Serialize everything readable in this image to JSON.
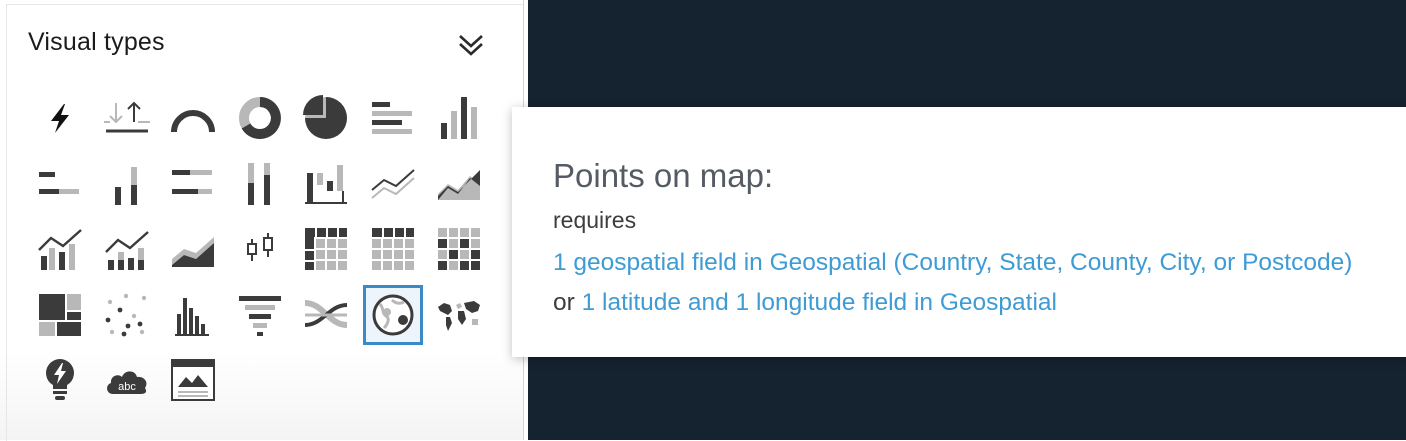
{
  "panel": {
    "title": "Visual types",
    "collapse_icon": "double-chevron-down-icon"
  },
  "visual_types": [
    {
      "name": "autograph",
      "icon": "lightning-bolt-icon"
    },
    {
      "name": "kpi",
      "icon": "kpi-arrows-icon"
    },
    {
      "name": "gauge-chart",
      "icon": "gauge-icon"
    },
    {
      "name": "donut-chart",
      "icon": "donut-icon"
    },
    {
      "name": "pie-chart",
      "icon": "pie-icon"
    },
    {
      "name": "horizontal-bar-chart",
      "icon": "horizontal-bar-icon"
    },
    {
      "name": "vertical-bar-chart",
      "icon": "vertical-bar-icon"
    },
    {
      "name": "horizontal-stacked-bar-chart",
      "icon": "horizontal-stacked-bar-icon"
    },
    {
      "name": "vertical-stacked-bar-chart",
      "icon": "vertical-stacked-bar-icon"
    },
    {
      "name": "horizontal-stacked-100-bar-chart",
      "icon": "horizontal-stacked-100-bar-icon"
    },
    {
      "name": "vertical-stacked-100-bar-chart",
      "icon": "vertical-stacked-100-bar-icon"
    },
    {
      "name": "waterfall-chart",
      "icon": "waterfall-icon"
    },
    {
      "name": "line-chart",
      "icon": "line-chart-icon"
    },
    {
      "name": "area-line-chart",
      "icon": "area-chart-icon"
    },
    {
      "name": "clustered-bar-combo-chart",
      "icon": "bar-line-combo-icon"
    },
    {
      "name": "stacked-bar-combo-chart",
      "icon": "stacked-bar-line-combo-icon"
    },
    {
      "name": "stacked-area-chart",
      "icon": "stacked-area-icon"
    },
    {
      "name": "box-plot",
      "icon": "box-plot-icon"
    },
    {
      "name": "pivot-table",
      "icon": "pivot-table-icon"
    },
    {
      "name": "table",
      "icon": "table-icon"
    },
    {
      "name": "heat-map",
      "icon": "heat-map-icon"
    },
    {
      "name": "tree-map",
      "icon": "tree-map-icon"
    },
    {
      "name": "scatter-plot",
      "icon": "scatter-plot-icon"
    },
    {
      "name": "histogram",
      "icon": "histogram-icon"
    },
    {
      "name": "funnel-chart",
      "icon": "funnel-icon"
    },
    {
      "name": "sankey-diagram",
      "icon": "sankey-icon"
    },
    {
      "name": "points-on-map",
      "icon": "points-on-map-icon",
      "selected": true
    },
    {
      "name": "filled-map",
      "icon": "world-map-icon"
    },
    {
      "name": "insight",
      "icon": "lightbulb-icon"
    },
    {
      "name": "word-cloud",
      "icon": "word-cloud-icon"
    },
    {
      "name": "custom-visual-content",
      "icon": "custom-content-icon"
    }
  ],
  "word_cloud_label": "abc",
  "tooltip": {
    "title": "Points on map:",
    "requires": "requires",
    "link1": "1 geospatial field in Geospatial (Country, State, County, City, or Postcode)",
    "or": " or ",
    "link2": "1 latitude and 1 longitude field in Geospatial"
  },
  "colors": {
    "link": "#3e9bd3",
    "selected_border": "#3a8ac7",
    "dark_background": "#15222f",
    "icon_dark": "#3b3b3b",
    "icon_light": "#b8b8b8"
  }
}
